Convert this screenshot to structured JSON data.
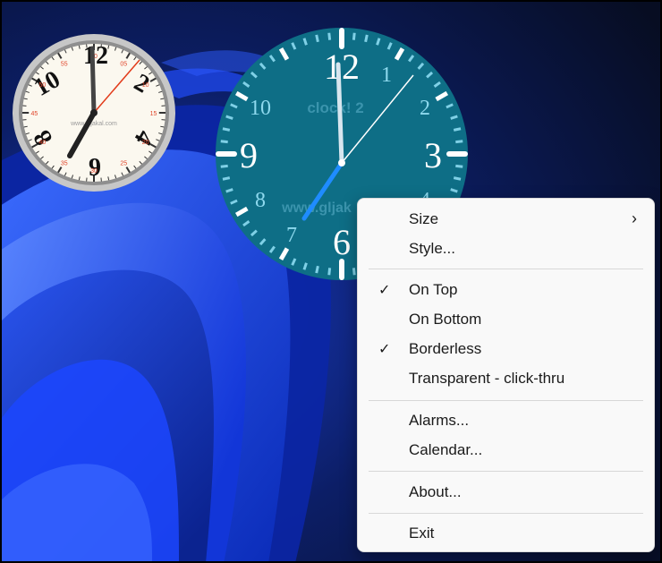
{
  "desktop": {
    "background": "#0a1326",
    "accent": "#2448ff"
  },
  "classic_clock": {
    "watermark": "www.gljakal.com",
    "hour_numerals": [
      "12",
      "2",
      "4",
      "9",
      "8",
      "10"
    ],
    "minute_labels": [
      "60",
      "05",
      "10",
      "15",
      "20",
      "25",
      "30",
      "35",
      "40",
      "45",
      "50",
      "55"
    ]
  },
  "teal_clock": {
    "face_color": "#0e6e86",
    "numerals": [
      "12",
      "1",
      "2",
      "3",
      "4",
      "6",
      "7",
      "8",
      "9",
      "10"
    ],
    "title_text": "clock! 2",
    "watermark": "www.gljak"
  },
  "menu": {
    "items": [
      {
        "label": "Size",
        "checked": false,
        "submenu": true
      },
      {
        "label": "Style...",
        "checked": false
      },
      {
        "label": "On Top",
        "checked": true
      },
      {
        "label": "On Bottom",
        "checked": false
      },
      {
        "label": "Borderless",
        "checked": true
      },
      {
        "label": "Transparent - click-thru",
        "checked": false
      },
      {
        "label": "Alarms...",
        "checked": false
      },
      {
        "label": "Calendar...",
        "checked": false
      },
      {
        "label": "About...",
        "checked": false
      },
      {
        "label": "Exit",
        "checked": false
      }
    ],
    "check_glyph": "✓",
    "submenu_glyph": "›"
  }
}
